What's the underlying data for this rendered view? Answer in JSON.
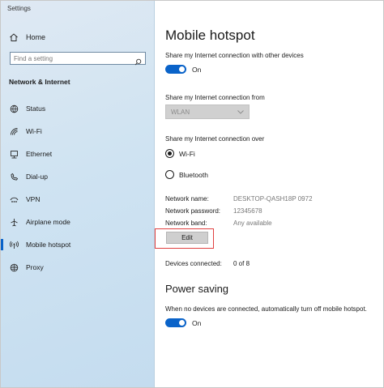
{
  "app": {
    "title": "Settings"
  },
  "sidebar": {
    "home_label": "Home",
    "search_placeholder": "Find a setting",
    "section_title": "Network & Internet",
    "items": [
      {
        "label": "Status",
        "icon": "globe-status-icon"
      },
      {
        "label": "Wi-Fi",
        "icon": "wifi-icon"
      },
      {
        "label": "Ethernet",
        "icon": "ethernet-icon"
      },
      {
        "label": "Dial-up",
        "icon": "phone-icon"
      },
      {
        "label": "VPN",
        "icon": "vpn-icon"
      },
      {
        "label": "Airplane mode",
        "icon": "airplane-icon"
      },
      {
        "label": "Mobile hotspot",
        "icon": "hotspot-icon",
        "active": true
      },
      {
        "label": "Proxy",
        "icon": "globe-icon"
      }
    ]
  },
  "main": {
    "title": "Mobile hotspot",
    "share_connection": {
      "label": "Share my Internet connection with other devices",
      "toggle_text": "On",
      "on": true
    },
    "share_from": {
      "label": "Share my Internet connection from",
      "value": "WLAN"
    },
    "share_over": {
      "label": "Share my Internet connection over",
      "options": [
        "Wi-Fi",
        "Bluetooth"
      ],
      "selected": "Wi-Fi"
    },
    "network": {
      "name_label": "Network name:",
      "name_value": "DESKTOP-QASH18P 0972",
      "password_label": "Network password:",
      "password_value": "12345678",
      "band_label": "Network band:",
      "band_value": "Any available",
      "edit_label": "Edit"
    },
    "devices": {
      "label": "Devices connected:",
      "value": "0 of 8"
    },
    "power_saving": {
      "title": "Power saving",
      "description": "When no devices are connected, automatically turn off mobile hotspot.",
      "toggle_text": "On",
      "on": true
    }
  },
  "colors": {
    "accent": "#0a63c9",
    "highlight_box": "#e04040",
    "sidebar_bg": "#cfe3f2"
  }
}
